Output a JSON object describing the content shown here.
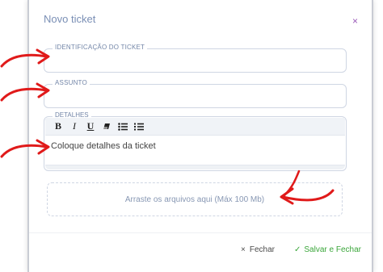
{
  "modal": {
    "title": "Novo ticket",
    "close_glyph": "×"
  },
  "fields": {
    "identification": {
      "label": "IDENTIFICAÇÃO DO TICKET",
      "value": "",
      "placeholder": ""
    },
    "subject": {
      "label": "ASSUNTO",
      "value": "",
      "placeholder": ""
    },
    "details": {
      "label": "DETALHES",
      "text": "Coloque detalhes da ticket"
    }
  },
  "toolbar": {
    "bold": "B",
    "italic": "I",
    "underline": "U",
    "items": [
      "bold-icon",
      "italic-icon",
      "underline-icon",
      "eraser-icon",
      "bulleted-list-icon",
      "numbered-list-icon"
    ]
  },
  "dropzone": {
    "text": "Arraste os arquivos aqui (Máx 100 Mb)"
  },
  "footer": {
    "close_label": "Fechar",
    "close_glyph": "×",
    "save_label": "Salvar e Fechar",
    "save_glyph": "✓"
  },
  "colors": {
    "title": "#7a8fb5",
    "close": "#9a5ab8",
    "save": "#3aa63a",
    "annotation_arrow": "#e01a1a"
  },
  "annotations": [
    "arrow-icon",
    "arrow-icon",
    "arrow-icon",
    "arrow-icon"
  ]
}
